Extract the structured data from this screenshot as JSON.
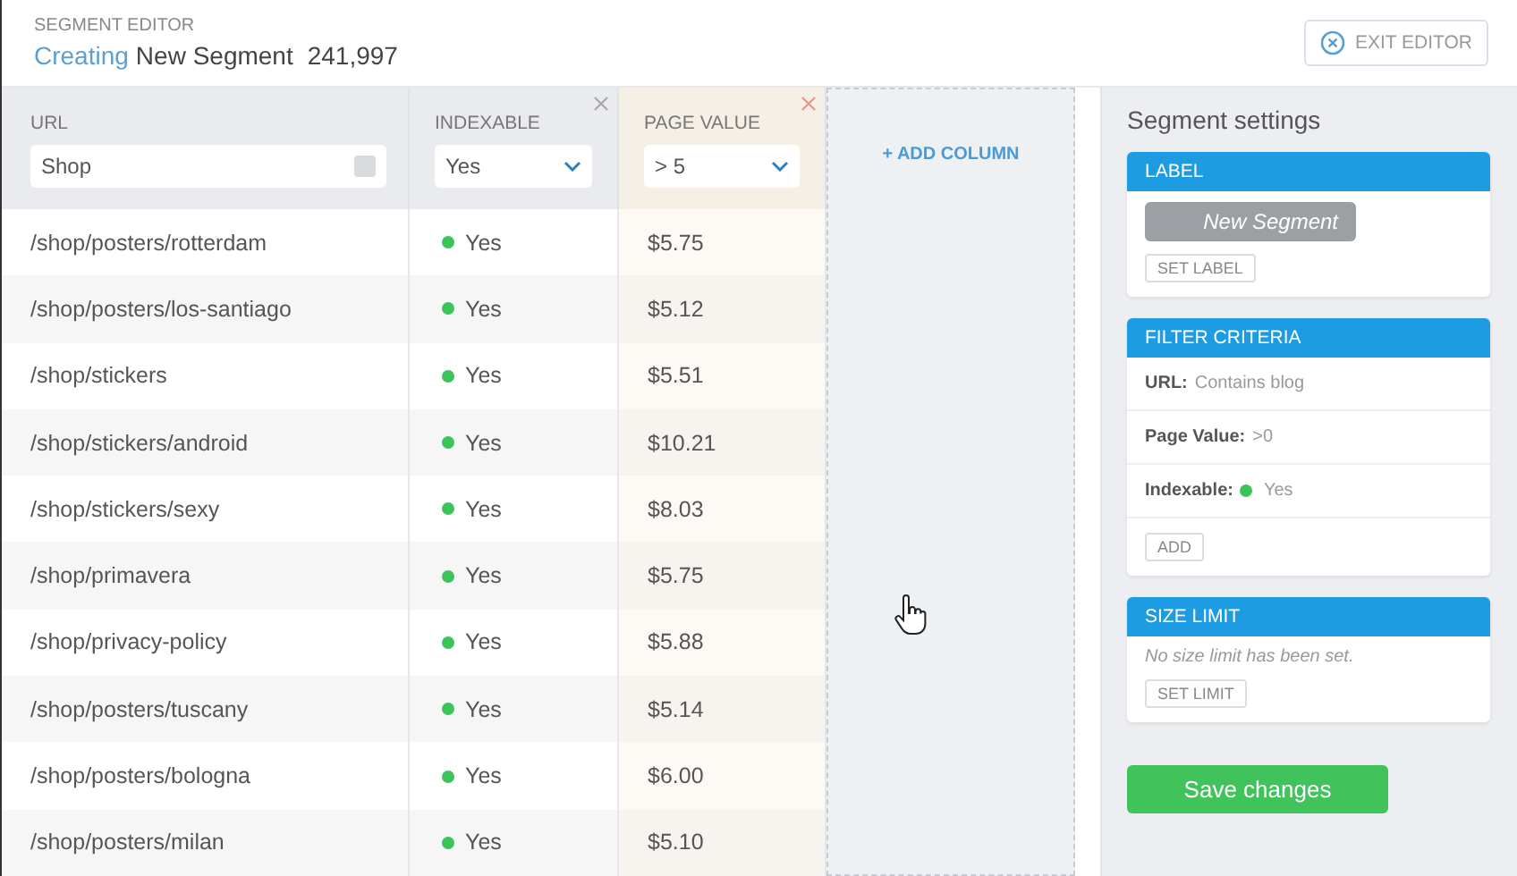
{
  "header": {
    "overline": "SEGMENT EDITOR",
    "status": "Creating",
    "name": "New Segment",
    "count": "241,997",
    "exit_button": "EXIT EDITOR"
  },
  "columns": [
    {
      "title": "URL",
      "kind": "text",
      "value": "Shop",
      "removable": false,
      "highlighted": false
    },
    {
      "title": "INDEXABLE",
      "kind": "select",
      "value": "Yes",
      "removable": true,
      "highlighted": false
    },
    {
      "title": "PAGE VALUE",
      "kind": "select",
      "value": "> 5",
      "removable": true,
      "highlighted": true
    }
  ],
  "add_column": "+ ADD COLUMN",
  "rows": [
    {
      "url": "/shop/posters/rotterdam",
      "indexable": "Yes",
      "value": "$5.75"
    },
    {
      "url": "/shop/posters/los-santiago",
      "indexable": "Yes",
      "value": "$5.12"
    },
    {
      "url": "/shop/stickers",
      "indexable": "Yes",
      "value": "$5.51"
    },
    {
      "url": "/shop/stickers/android",
      "indexable": "Yes",
      "value": "$10.21"
    },
    {
      "url": "/shop/stickers/sexy",
      "indexable": "Yes",
      "value": "$8.03"
    },
    {
      "url": "/shop/primavera",
      "indexable": "Yes",
      "value": "$5.75"
    },
    {
      "url": "/shop/privacy-policy",
      "indexable": "Yes",
      "value": "$5.88"
    },
    {
      "url": "/shop/posters/tuscany",
      "indexable": "Yes",
      "value": "$5.14"
    },
    {
      "url": "/shop/posters/bologna",
      "indexable": "Yes",
      "value": "$6.00"
    },
    {
      "url": "/shop/posters/milan",
      "indexable": "Yes",
      "value": "$5.10"
    }
  ],
  "sidebar": {
    "title": "Segment settings",
    "label_card": {
      "heading": "LABEL",
      "label": "New Segment",
      "button": "SET LABEL"
    },
    "filter_card": {
      "heading": "FILTER CRITERIA",
      "criteria": [
        {
          "name": "URL:",
          "value": "Contains blog",
          "kind": "text"
        },
        {
          "name": "Page Value:",
          "value": ">0",
          "kind": "text"
        },
        {
          "name": "Indexable:",
          "value": "Yes",
          "kind": "status"
        }
      ],
      "button": "ADD"
    },
    "size_card": {
      "heading": "SIZE LIMIT",
      "note": "No size limit has been set.",
      "button": "SET LIMIT"
    },
    "save_button": "Save changes"
  }
}
